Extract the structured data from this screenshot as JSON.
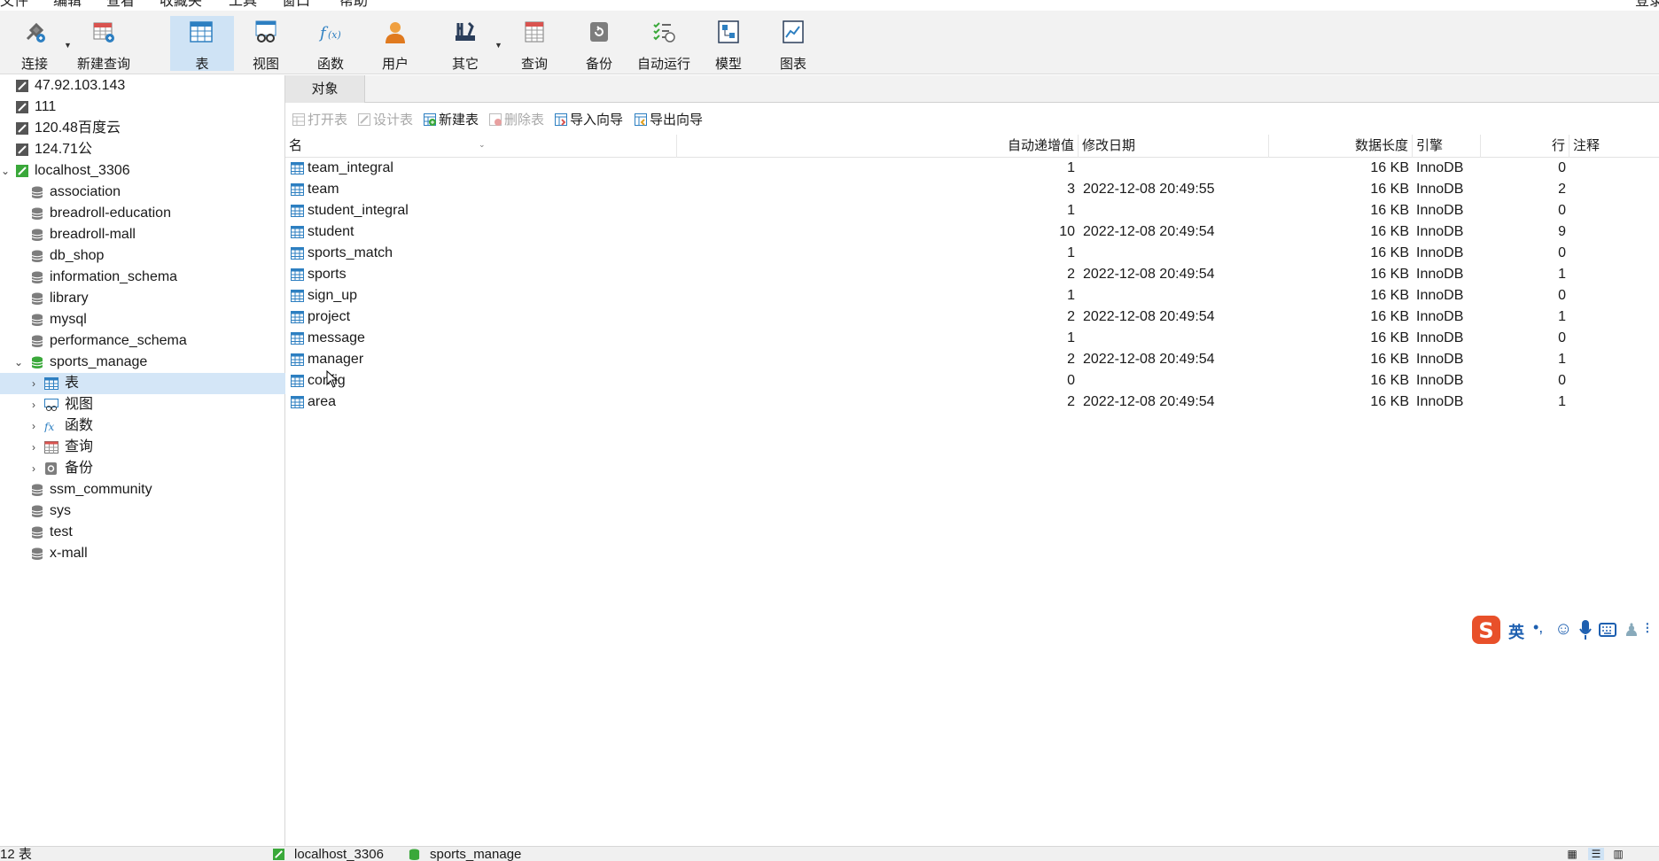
{
  "menu": {
    "items": [
      "文件",
      "编辑",
      "查看",
      "收藏夹",
      "工具",
      "窗口",
      "帮助"
    ],
    "right": "登录"
  },
  "toolbar": {
    "connect": "连接",
    "new_query": "新建查询",
    "table": "表",
    "view": "视图",
    "function": "函数",
    "user": "用户",
    "other": "其它",
    "query": "查询",
    "backup": "备份",
    "autorun": "自动运行",
    "model": "模型",
    "chart": "图表"
  },
  "sidebar": {
    "connections": [
      "47.92.103.143",
      "111",
      "120.48百度云",
      "124.71公"
    ],
    "localhost": "localhost_3306",
    "databases_before": [
      "association",
      "breadroll-education",
      "breadroll-mall",
      "db_shop",
      "information_schema",
      "library",
      "mysql",
      "performance_schema"
    ],
    "active_db": "sports_manage",
    "active_children": [
      "表",
      "视图",
      "函数",
      "查询",
      "备份"
    ],
    "databases_after": [
      "ssm_community",
      "sys",
      "test",
      "x-mall"
    ]
  },
  "tabs": {
    "objects": "对象"
  },
  "objtoolbar": {
    "open_table": "打开表",
    "design_table": "设计表",
    "new_table": "新建表",
    "delete_table": "删除表",
    "import_wizard": "导入向导",
    "export_wizard": "导出向导"
  },
  "grid": {
    "headers": {
      "name": "名",
      "auto_inc": "自动递增值",
      "modified": "修改日期",
      "data_length": "数据长度",
      "engine": "引擎",
      "rows": "行",
      "comment": "注释"
    },
    "rows": [
      {
        "name": "team_integral",
        "auto_inc": "1",
        "modified": "",
        "data_length": "16 KB",
        "engine": "InnoDB",
        "rows": "0"
      },
      {
        "name": "team",
        "auto_inc": "3",
        "modified": "2022-12-08 20:49:55",
        "data_length": "16 KB",
        "engine": "InnoDB",
        "rows": "2"
      },
      {
        "name": "student_integral",
        "auto_inc": "1",
        "modified": "",
        "data_length": "16 KB",
        "engine": "InnoDB",
        "rows": "0"
      },
      {
        "name": "student",
        "auto_inc": "10",
        "modified": "2022-12-08 20:49:54",
        "data_length": "16 KB",
        "engine": "InnoDB",
        "rows": "9"
      },
      {
        "name": "sports_match",
        "auto_inc": "1",
        "modified": "",
        "data_length": "16 KB",
        "engine": "InnoDB",
        "rows": "0"
      },
      {
        "name": "sports",
        "auto_inc": "2",
        "modified": "2022-12-08 20:49:54",
        "data_length": "16 KB",
        "engine": "InnoDB",
        "rows": "1"
      },
      {
        "name": "sign_up",
        "auto_inc": "1",
        "modified": "",
        "data_length": "16 KB",
        "engine": "InnoDB",
        "rows": "0"
      },
      {
        "name": "project",
        "auto_inc": "2",
        "modified": "2022-12-08 20:49:54",
        "data_length": "16 KB",
        "engine": "InnoDB",
        "rows": "1"
      },
      {
        "name": "message",
        "auto_inc": "1",
        "modified": "",
        "data_length": "16 KB",
        "engine": "InnoDB",
        "rows": "0"
      },
      {
        "name": "manager",
        "auto_inc": "2",
        "modified": "2022-12-08 20:49:54",
        "data_length": "16 KB",
        "engine": "InnoDB",
        "rows": "1"
      },
      {
        "name": "config",
        "auto_inc": "0",
        "modified": "",
        "data_length": "16 KB",
        "engine": "InnoDB",
        "rows": "0"
      },
      {
        "name": "area",
        "auto_inc": "2",
        "modified": "2022-12-08 20:49:54",
        "data_length": "16 KB",
        "engine": "InnoDB",
        "rows": "1"
      }
    ]
  },
  "status": {
    "count": "12 表",
    "connection": "localhost_3306",
    "database": "sports_manage"
  },
  "ime": {
    "mode": "英"
  },
  "colors": {
    "accent": "#2d7fc1",
    "selected": "#d4e6f7",
    "db_active": "#3aa83a",
    "ime_brand": "#e8502a"
  }
}
